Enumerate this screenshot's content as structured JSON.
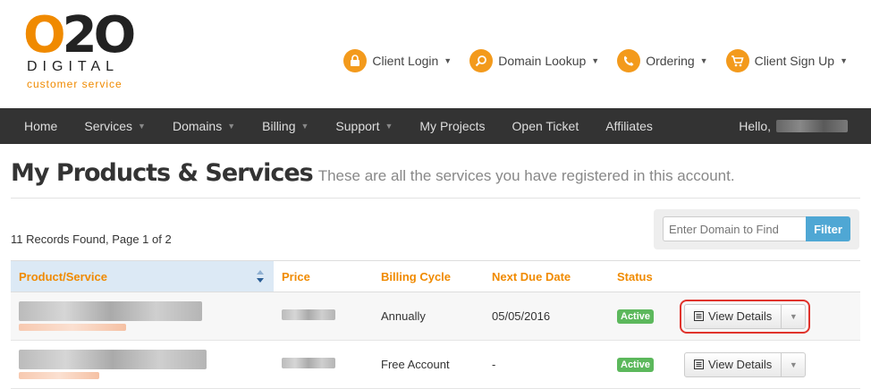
{
  "logo": {
    "mark_o": "O",
    "mark_rest": "2O",
    "line1": "DIGITAL",
    "line2": "customer service"
  },
  "topnav": [
    {
      "label": "Client Login",
      "icon": "lock-icon"
    },
    {
      "label": "Domain Lookup",
      "icon": "search-icon"
    },
    {
      "label": "Ordering",
      "icon": "phone-icon"
    },
    {
      "label": "Client Sign Up",
      "icon": "cart-icon"
    }
  ],
  "mainnav": [
    {
      "label": "Home",
      "dropdown": false
    },
    {
      "label": "Services",
      "dropdown": true
    },
    {
      "label": "Domains",
      "dropdown": true
    },
    {
      "label": "Billing",
      "dropdown": true
    },
    {
      "label": "Support",
      "dropdown": true
    },
    {
      "label": "My Projects",
      "dropdown": false
    },
    {
      "label": "Open Ticket",
      "dropdown": false
    },
    {
      "label": "Affiliates",
      "dropdown": false
    }
  ],
  "hello": "Hello,",
  "page": {
    "title": "My Products & Services",
    "subtitle": "These are all the services you have registered in this account."
  },
  "records": "11 Records Found, Page 1 of 2",
  "filter": {
    "placeholder": "Enter Domain to Find",
    "button": "Filter"
  },
  "table": {
    "headers": [
      "Product/Service",
      "Price",
      "Billing Cycle",
      "Next Due Date",
      "Status"
    ],
    "rows": [
      {
        "billing_cycle": "Annually",
        "next_due": "05/05/2016",
        "status": "Active",
        "action": "View Details"
      },
      {
        "billing_cycle": "Free Account",
        "next_due": "-",
        "status": "Active",
        "action": "View Details"
      }
    ]
  },
  "colors": {
    "brand": "#f08a00",
    "nav_bg": "#333333",
    "active": "#5cb85c",
    "filter": "#4fa7d4",
    "highlight": "#e0332c"
  }
}
